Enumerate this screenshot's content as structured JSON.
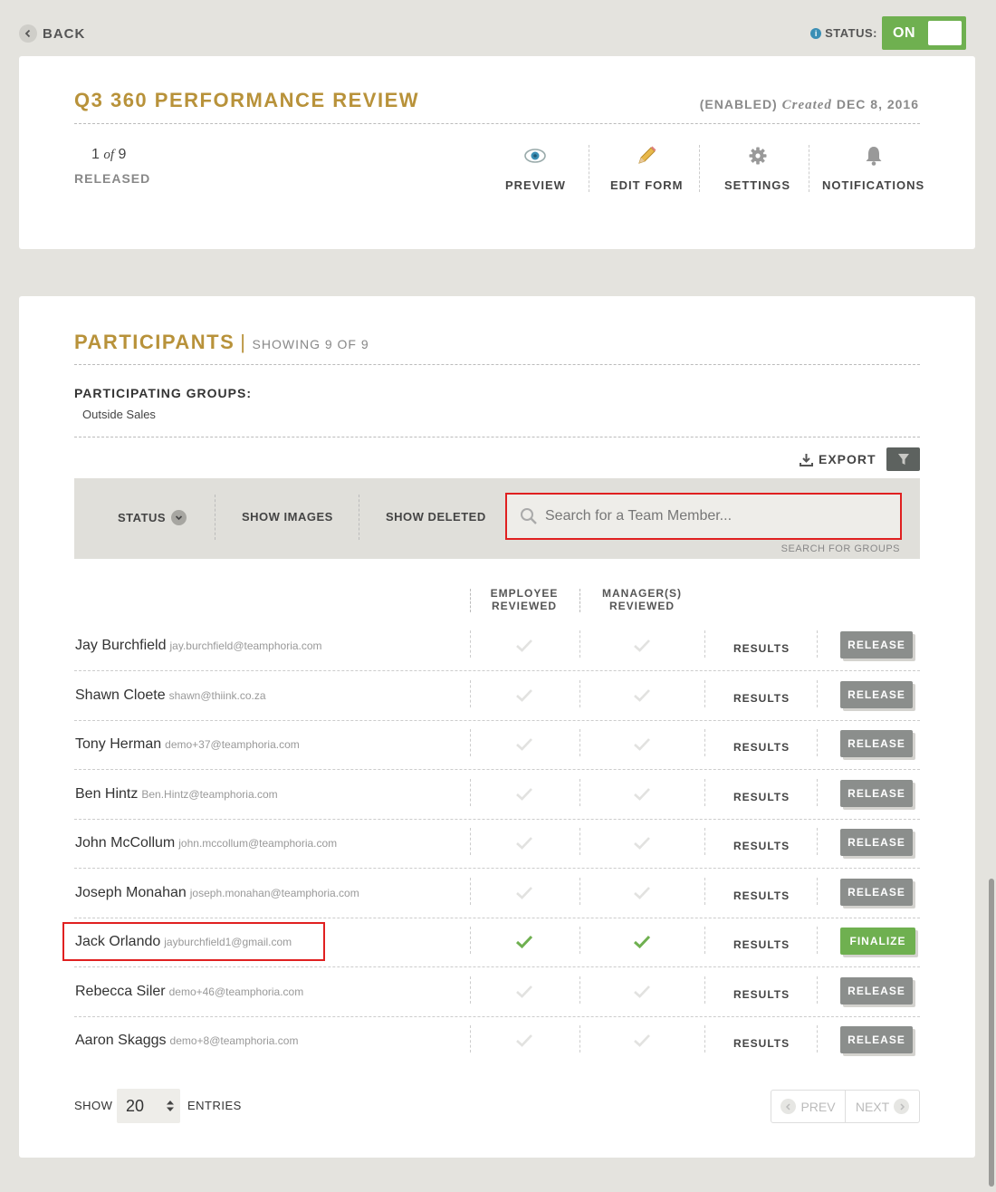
{
  "topbar": {
    "back_label": "BACK",
    "status_label": "STATUS:",
    "status_value": "ON"
  },
  "review": {
    "title": "Q3 360 PERFORMANCE REVIEW",
    "enabled": "(ENABLED)",
    "created_label": "Created",
    "created_date": "DEC 8, 2016",
    "released_num": "1",
    "released_of": "of",
    "released_total": "9",
    "released_label": "RELEASED",
    "actions": {
      "preview": "PREVIEW",
      "edit_form": "EDIT FORM",
      "settings": "SETTINGS",
      "notifications": "NOTIFICATIONS"
    }
  },
  "participants": {
    "title": "PARTICIPANTS",
    "separator": "|",
    "showing": "SHOWING 9 OF 9",
    "groups_label": "PARTICIPATING GROUPS:",
    "groups_value": "Outside Sales",
    "export_label": "EXPORT",
    "filters": {
      "status": "STATUS",
      "show_images": "SHOW IMAGES",
      "show_deleted": "SHOW DELETED",
      "search_placeholder": "Search for a Team Member...",
      "search_groups": "SEARCH FOR GROUPS"
    },
    "columns": {
      "employee_1": "EMPLOYEE",
      "employee_2": "REVIEWED",
      "manager_1": "MANAGER(S)",
      "manager_2": "REVIEWED"
    },
    "rows": [
      {
        "name": "Jay Burchfield",
        "email": "jay.burchfield@teamphoria.com",
        "employee_reviewed": false,
        "manager_reviewed": false,
        "results": "RESULTS",
        "action": "RELEASE"
      },
      {
        "name": "Shawn Cloete",
        "email": "shawn@thiink.co.za",
        "employee_reviewed": false,
        "manager_reviewed": false,
        "results": "RESULTS",
        "action": "RELEASE"
      },
      {
        "name": "Tony Herman",
        "email": "demo+37@teamphoria.com",
        "employee_reviewed": false,
        "manager_reviewed": false,
        "results": "RESULTS",
        "action": "RELEASE"
      },
      {
        "name": "Ben Hintz",
        "email": "Ben.Hintz@teamphoria.com",
        "employee_reviewed": false,
        "manager_reviewed": false,
        "results": "RESULTS",
        "action": "RELEASE"
      },
      {
        "name": "John McCollum",
        "email": "john.mccollum@teamphoria.com",
        "employee_reviewed": false,
        "manager_reviewed": false,
        "results": "RESULTS",
        "action": "RELEASE"
      },
      {
        "name": "Joseph Monahan",
        "email": "joseph.monahan@teamphoria.com",
        "employee_reviewed": false,
        "manager_reviewed": false,
        "results": "RESULTS",
        "action": "RELEASE"
      },
      {
        "name": "Jack Orlando",
        "email": "jayburchfield1@gmail.com",
        "employee_reviewed": true,
        "manager_reviewed": true,
        "results": "RESULTS",
        "action": "FINALIZE"
      },
      {
        "name": "Rebecca Siler",
        "email": "demo+46@teamphoria.com",
        "employee_reviewed": false,
        "manager_reviewed": false,
        "results": "RESULTS",
        "action": "RELEASE"
      },
      {
        "name": "Aaron Skaggs",
        "email": "demo+8@teamphoria.com",
        "employee_reviewed": false,
        "manager_reviewed": false,
        "results": "RESULTS",
        "action": "RELEASE"
      }
    ],
    "footer": {
      "show_label": "SHOW",
      "entries_value": "20",
      "entries_label": "ENTRIES",
      "prev_label": "PREV",
      "next_label": "NEXT"
    }
  },
  "colors": {
    "gold": "#b8923a",
    "green": "#6fb050",
    "gray_button": "#8b8e8c",
    "highlight": "#e02020"
  }
}
